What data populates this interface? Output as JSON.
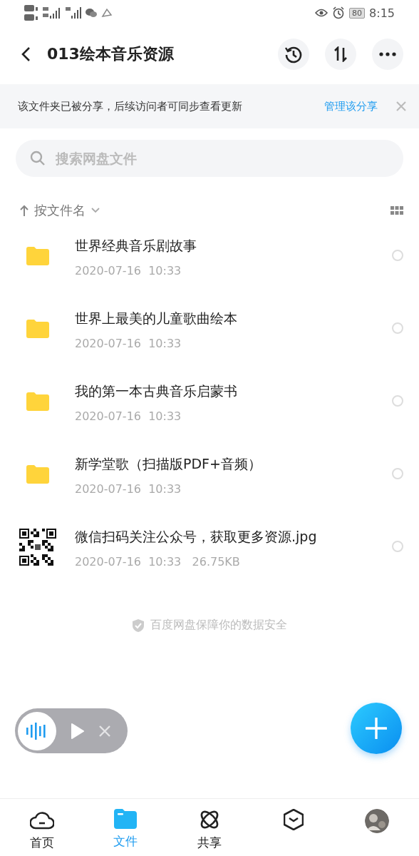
{
  "status_bar": {
    "battery": "80",
    "time": "8:15"
  },
  "header": {
    "title": "013绘本音乐资源"
  },
  "share_banner": {
    "text": "该文件夹已被分享，后续访问者可同步查看更新",
    "link": "管理该分享"
  },
  "search": {
    "placeholder": "搜索网盘文件"
  },
  "sort": {
    "label": "按文件名"
  },
  "files": [
    {
      "kind": "folder",
      "name": "世界经典音乐剧故事",
      "meta": "2020-07-16  10:33",
      "selected": false
    },
    {
      "kind": "folder",
      "name": "世界上最美的儿童歌曲绘本",
      "meta": "2020-07-16  10:33",
      "selected": false
    },
    {
      "kind": "folder",
      "name": "我的第一本古典音乐启蒙书",
      "meta": "2020-07-16  10:33",
      "selected": false
    },
    {
      "kind": "folder",
      "name": "新学堂歌（扫描版PDF+音频）",
      "meta": "2020-07-16  10:33",
      "selected": false
    },
    {
      "kind": "image",
      "name": "微信扫码关注公众号，获取更多资源.jpg",
      "meta": "2020-07-16  10:33   26.75KB",
      "selected": false
    }
  ],
  "footer_note": "百度网盘保障你的数据安全",
  "nav": [
    {
      "kind": "home",
      "label": "首页",
      "selected": false
    },
    {
      "kind": "files",
      "label": "文件",
      "selected": true
    },
    {
      "kind": "share",
      "label": "共享",
      "selected": false
    },
    {
      "kind": "explore",
      "selected": false
    },
    {
      "kind": "avatar",
      "selected": false
    }
  ]
}
